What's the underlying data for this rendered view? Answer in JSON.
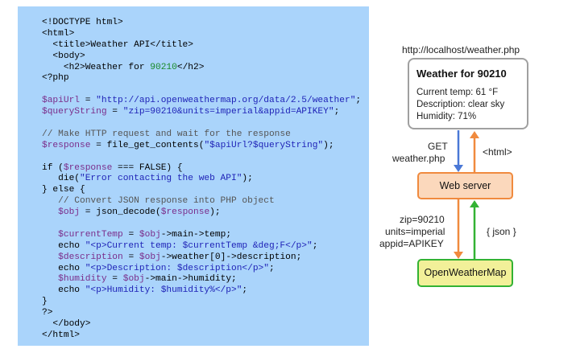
{
  "code": {
    "lines": [
      [
        {
          "t": "<!DOCTYPE html>",
          "c": ""
        }
      ],
      [
        {
          "t": "<html>",
          "c": ""
        }
      ],
      [
        {
          "t": "  <title>Weather API</title>",
          "c": ""
        }
      ],
      [
        {
          "t": "  <body>",
          "c": ""
        }
      ],
      [
        {
          "t": "    <h2>Weather for ",
          "c": ""
        },
        {
          "t": "90210",
          "c": "c-num"
        },
        {
          "t": "</h2>",
          "c": ""
        }
      ],
      [
        {
          "t": "<?php",
          "c": ""
        }
      ],
      [
        {
          "t": "",
          "c": ""
        }
      ],
      [
        {
          "t": "$apiUrl",
          "c": "c-var"
        },
        {
          "t": " = ",
          "c": ""
        },
        {
          "t": "\"http://api.openweathermap.org/data/2.5/weather\"",
          "c": "c-str"
        },
        {
          "t": ";",
          "c": ""
        }
      ],
      [
        {
          "t": "$queryString",
          "c": "c-var"
        },
        {
          "t": " = ",
          "c": ""
        },
        {
          "t": "\"zip=90210&units=imperial&appid=APIKEY\"",
          "c": "c-str"
        },
        {
          "t": ";",
          "c": ""
        }
      ],
      [
        {
          "t": "",
          "c": ""
        }
      ],
      [
        {
          "t": "// Make HTTP request and wait for the response",
          "c": "c-com"
        }
      ],
      [
        {
          "t": "$response",
          "c": "c-var"
        },
        {
          "t": " = file_get_contents(",
          "c": ""
        },
        {
          "t": "\"$apiUrl?$queryString\"",
          "c": "c-str"
        },
        {
          "t": ");",
          "c": ""
        }
      ],
      [
        {
          "t": "",
          "c": ""
        }
      ],
      [
        {
          "t": "if (",
          "c": ""
        },
        {
          "t": "$response",
          "c": "c-var"
        },
        {
          "t": " === FALSE) {",
          "c": ""
        }
      ],
      [
        {
          "t": "   die(",
          "c": ""
        },
        {
          "t": "\"Error contacting the web API\"",
          "c": "c-str"
        },
        {
          "t": ");",
          "c": ""
        }
      ],
      [
        {
          "t": "} else {",
          "c": ""
        }
      ],
      [
        {
          "t": "   // Convert JSON response into PHP object",
          "c": "c-com"
        }
      ],
      [
        {
          "t": "   ",
          "c": ""
        },
        {
          "t": "$obj",
          "c": "c-var"
        },
        {
          "t": " = json_decode(",
          "c": ""
        },
        {
          "t": "$response",
          "c": "c-var"
        },
        {
          "t": ");",
          "c": ""
        }
      ],
      [
        {
          "t": "",
          "c": ""
        }
      ],
      [
        {
          "t": "   ",
          "c": ""
        },
        {
          "t": "$currentTemp",
          "c": "c-var"
        },
        {
          "t": " = ",
          "c": ""
        },
        {
          "t": "$obj",
          "c": "c-var"
        },
        {
          "t": "->main->temp;",
          "c": ""
        }
      ],
      [
        {
          "t": "   echo ",
          "c": ""
        },
        {
          "t": "\"<p>Current temp: $currentTemp &deg;F</p>\"",
          "c": "c-str"
        },
        {
          "t": ";",
          "c": ""
        }
      ],
      [
        {
          "t": "   ",
          "c": ""
        },
        {
          "t": "$description",
          "c": "c-var"
        },
        {
          "t": " = ",
          "c": ""
        },
        {
          "t": "$obj",
          "c": "c-var"
        },
        {
          "t": "->weather[0]->description;",
          "c": ""
        }
      ],
      [
        {
          "t": "   echo ",
          "c": ""
        },
        {
          "t": "\"<p>Description: $description</p>\"",
          "c": "c-str"
        },
        {
          "t": ";",
          "c": ""
        }
      ],
      [
        {
          "t": "   ",
          "c": ""
        },
        {
          "t": "$humidity",
          "c": "c-var"
        },
        {
          "t": " = ",
          "c": ""
        },
        {
          "t": "$obj",
          "c": "c-var"
        },
        {
          "t": "->main->humidity;",
          "c": ""
        }
      ],
      [
        {
          "t": "   echo ",
          "c": ""
        },
        {
          "t": "\"<p>Humidity: $humidity%</p>\"",
          "c": "c-str"
        },
        {
          "t": ";",
          "c": ""
        }
      ],
      [
        {
          "t": "}",
          "c": ""
        }
      ],
      [
        {
          "t": "?>",
          "c": ""
        }
      ],
      [
        {
          "t": "  </body>",
          "c": ""
        }
      ],
      [
        {
          "t": "</html>",
          "c": ""
        }
      ]
    ]
  },
  "diagram": {
    "url": "http://localhost/weather.php",
    "browser_title": "Weather for 90210",
    "browser_lines": [
      "Current temp: 61 °F",
      "Description: clear sky",
      "Humidity: 71%"
    ],
    "request_label": [
      "GET",
      "weather.php"
    ],
    "response_label": "<html>",
    "web_server": "Web server",
    "api_request_label": [
      "zip=90210",
      "units=imperial",
      "appid=APIKEY"
    ],
    "api_response_label": "{ json }",
    "api_name": "OpenWeatherMap",
    "colors": {
      "get_arrow": "#4a78d6",
      "html_arrow": "#f08a3e",
      "api_request_arrow": "#f08a3e",
      "json_arrow": "#33b233"
    }
  }
}
